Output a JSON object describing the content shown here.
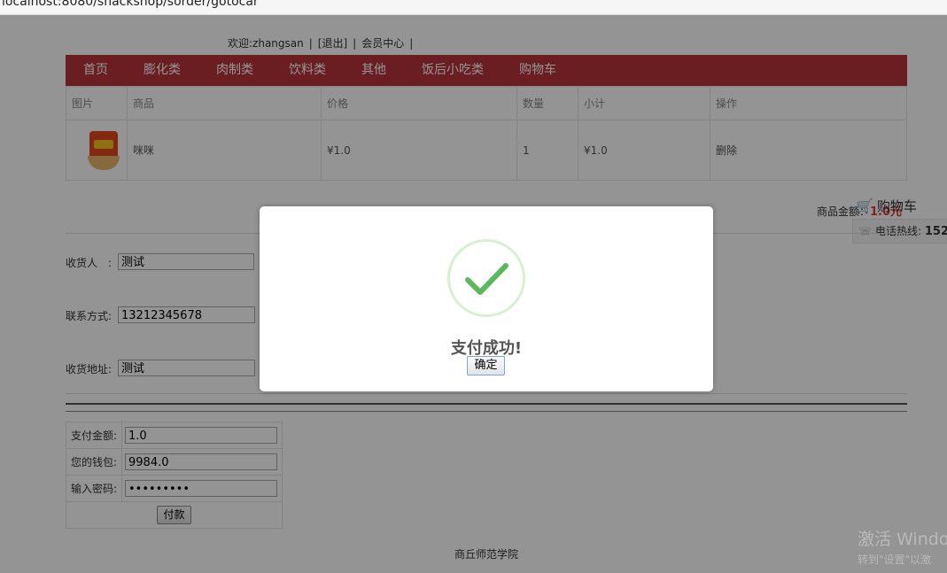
{
  "browser": {
    "url": "localhost:8080/snackshop/sorder/gotocar"
  },
  "header": {
    "welcome": "欢迎:zhangsan",
    "logout": "[退出]",
    "member_center": "会员中心",
    "separator": "|"
  },
  "nav": {
    "items": [
      "首页",
      "膨化类",
      "肉制类",
      "饮料类",
      "其他",
      "饭后小吃类",
      "购物车"
    ],
    "bar_color": "#b8343a"
  },
  "cart": {
    "columns": [
      "图片",
      "商品",
      "价格",
      "数量",
      "小计",
      "操作"
    ],
    "rows": [
      {
        "image_icon": "snack-product-image",
        "name": "咪咪",
        "price": "¥1.0",
        "qty": "1",
        "subtotal": "¥1.0",
        "action": "删除"
      }
    ]
  },
  "amount": {
    "label": "商品金额：",
    "value": "1.0元"
  },
  "sidebar": {
    "cart_label": "购物车",
    "hotline_label": "电话热线:",
    "hotline_number": "152"
  },
  "form": {
    "receiver_label": "收货人　:",
    "receiver_value": "测试",
    "phone_label": "联系方式:",
    "phone_value": "13212345678",
    "address_label": "收货地址:",
    "address_value": "测试"
  },
  "payment": {
    "amount_label": "支付金额:",
    "amount_value": "1.0",
    "wallet_label": "您的钱包:",
    "wallet_value": "9984.0",
    "password_label": "输入密码:",
    "password_value": "•••••••••",
    "pay_button": "付款"
  },
  "footer": {
    "text": "商丘师范学院"
  },
  "watermark": {
    "line1": "激活 Windo",
    "line2": "转到\"设置\"以激"
  },
  "modal": {
    "title": "支付成功!",
    "confirm": "确定",
    "icon": "check-icon",
    "accent": "#5cb85c"
  }
}
